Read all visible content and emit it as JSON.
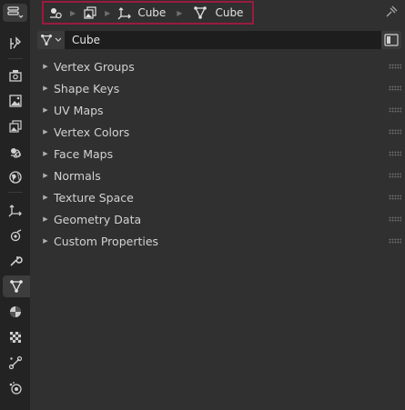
{
  "breadcrumb": {
    "object_name": "Cube",
    "mesh_name": "Cube"
  },
  "datablock": {
    "name": "Cube"
  },
  "panels": [
    {
      "label": "Vertex Groups"
    },
    {
      "label": "Shape Keys"
    },
    {
      "label": "UV Maps"
    },
    {
      "label": "Vertex Colors"
    },
    {
      "label": "Face Maps"
    },
    {
      "label": "Normals"
    },
    {
      "label": "Texture Space"
    },
    {
      "label": "Geometry Data"
    },
    {
      "label": "Custom Properties"
    }
  ],
  "tabs": [
    {
      "icon": "tool-icon"
    },
    {
      "icon": "render-icon"
    },
    {
      "icon": "output-icon"
    },
    {
      "icon": "view-layer-icon"
    },
    {
      "icon": "scene-icon"
    },
    {
      "icon": "world-icon"
    },
    {
      "icon": "object-icon"
    },
    {
      "icon": "physics-icon"
    },
    {
      "icon": "modifier-icon"
    },
    {
      "icon": "mesh-data-icon"
    },
    {
      "icon": "material-icon"
    },
    {
      "icon": "texture-icon"
    },
    {
      "icon": "constraints-icon"
    },
    {
      "icon": "particles-icon"
    }
  ],
  "colors": {
    "highlight_border": "#9a1b3f",
    "background": "#303030",
    "tab_column": "#232323"
  }
}
